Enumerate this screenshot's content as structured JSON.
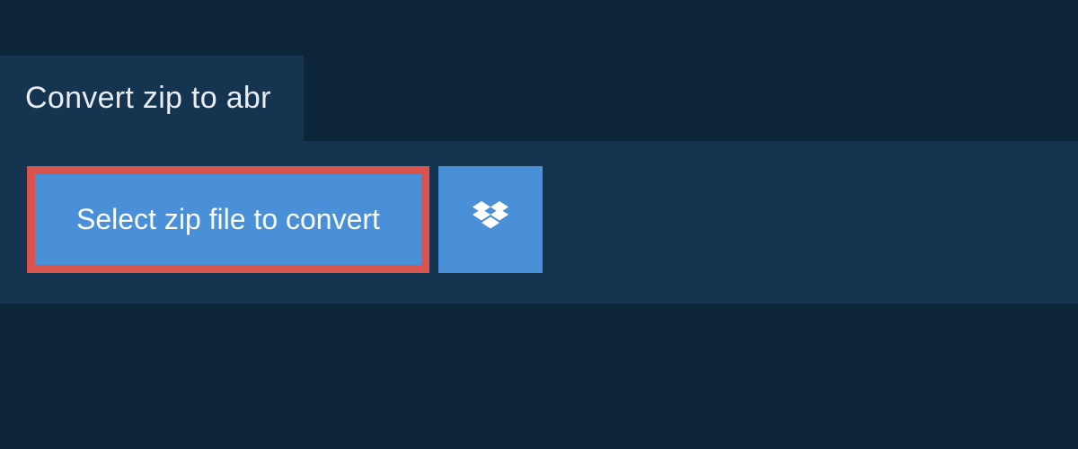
{
  "header": {
    "title": "Convert zip to abr"
  },
  "actions": {
    "select_label": "Select zip file to convert"
  },
  "colors": {
    "background": "#0d2538",
    "panel": "#153450",
    "button": "#4a90d9",
    "highlight_border": "#d9534f",
    "text_light": "#e8edf2",
    "text_white": "#fbfdff"
  }
}
